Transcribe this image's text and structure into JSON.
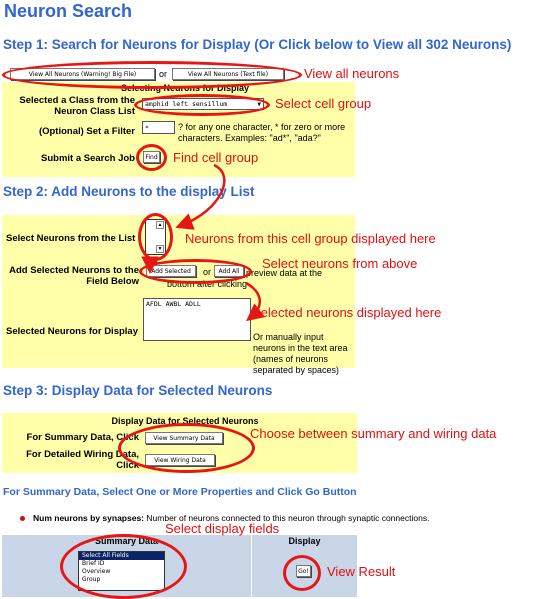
{
  "page_title": "Neuron Search",
  "step1": {
    "heading": "Step 1: Search for Neurons for Display (Or Click below to View all 302 Neurons)",
    "view_all_button": "View All Neurons (Warning! Big File)",
    "or": "or",
    "view_all_text_button": "View All Neurons (Text file)",
    "panel_title": "Selecting Neurons for Display",
    "class_label": "Selected a Class from the Neuron Class List",
    "class_value": "amphid left sensillum",
    "filter_label": "(Optional) Set a Filter",
    "filter_value": "*",
    "filter_help": "? for any one character, * for zero or more characters. Examples: \"ad*\", \"ada?\"",
    "submit_label": "Submit a Search Job",
    "find_button": "Find"
  },
  "step2": {
    "heading": "Step 2: Add Neurons to the display List",
    "select_label": "Select Neurons from the List",
    "add_label": "Add Selected Neurons to the Field Below",
    "add_selected_button": "Add Selected",
    "or": "or",
    "add_all_button": "Add All",
    "add_help_1": "preview data at the",
    "add_help_2": "bottom after clicking",
    "display_label": "Selected Neurons for Display",
    "display_value": "AFDL AWBL ADLL",
    "display_help": "Or manually input neurons in the text area (names of neurons separated by spaces)"
  },
  "step3": {
    "heading": "Step 3: Display Data for Selected Neurons",
    "panel_title": "Display Data for Selected Neurons",
    "summary_label": "For Summary Data, Click",
    "summary_button": "View Summary Data",
    "wiring_label": "For Detailed Wiring Data, Click",
    "wiring_button": "View Wiring Data"
  },
  "properties": {
    "heading": "For Summary Data, Select One or More Properties and Click Go Button",
    "bullet_term": "Num neurons by synapses:",
    "bullet_text": "Number of neurons connected to this neuron through synaptic connections.",
    "col_summary": "Summary Data",
    "col_display": "Display",
    "options": [
      "Select All Fields",
      "Brief ID",
      "Overview",
      "Group"
    ],
    "go_button": "Go!"
  },
  "annotations": {
    "view_all": "View all neurons",
    "select_group": "Select cell group",
    "find_group": "Find cell group",
    "from_group": "Neurons from this cell group displayed here",
    "select_above": "Select neurons from above",
    "selected_displayed": "Selected neurons displayed here",
    "choose": "Choose between summary and wiring data",
    "select_fields": "Select display fields",
    "view_result": "View Result"
  },
  "colors": {
    "heading": "#3366cc",
    "panel": "#ffffaa",
    "header_row": "#c8d6e8",
    "annotation": "#e01010"
  }
}
